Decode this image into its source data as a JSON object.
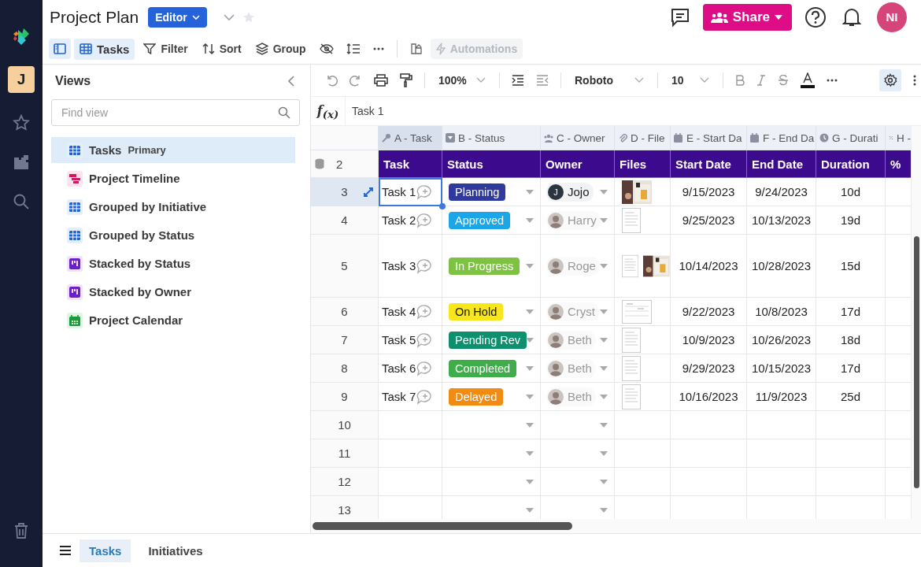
{
  "document": {
    "title": "Project Plan",
    "role": "Editor"
  },
  "header_actions": {
    "share": "Share",
    "avatar": "NI"
  },
  "toolbar": [
    {
      "kind": "panel",
      "selected": true
    },
    {
      "kind": "view",
      "label": "Tasks",
      "selected": true
    },
    {
      "kind": "filter",
      "label": "Filter"
    },
    {
      "kind": "sort",
      "label": "Sort"
    },
    {
      "kind": "group",
      "label": "Group"
    },
    {
      "kind": "hide"
    },
    {
      "kind": "rowheight"
    },
    {
      "kind": "more"
    },
    {
      "kind": "chart"
    },
    {
      "kind": "automations",
      "label": "Automations",
      "disabled": true
    }
  ],
  "workspace": {
    "initial": "J"
  },
  "views_panel": {
    "title": "Views",
    "search": {
      "placeholder": "Find view"
    },
    "views": [
      {
        "label": "Tasks",
        "badge": "Primary",
        "kind": "grid",
        "selected": true
      },
      {
        "label": "Project Timeline",
        "kind": "timeline",
        "selected": false
      },
      {
        "label": "Grouped by Initiative",
        "kind": "grid",
        "selected": false
      },
      {
        "label": "Grouped by Status",
        "kind": "grid",
        "selected": false
      },
      {
        "label": "Stacked by Status",
        "kind": "board",
        "selected": false
      },
      {
        "label": "Stacked by Owner",
        "kind": "board",
        "selected": false
      },
      {
        "label": "Project Calendar",
        "kind": "calendar",
        "selected": false
      }
    ]
  },
  "format_bar": {
    "zoom": "100%",
    "font": "Roboto",
    "size": "10",
    "settings_on": true
  },
  "formula_bar": {
    "symbol": "f$_{(x)}$",
    "value": "Task 1"
  },
  "grid": {
    "header_row": "2",
    "columns": [
      {
        "letter": "A - Task",
        "field": "Task",
        "selected": true
      },
      {
        "letter": "B - Status",
        "field": "Status",
        "selected": false
      },
      {
        "letter": "C - Owner",
        "field": "Owner",
        "selected": false
      },
      {
        "letter": "D - File",
        "field": "Files",
        "selected": false
      },
      {
        "letter": "E - Start Da",
        "field": "Start Date",
        "selected": false
      },
      {
        "letter": "F - End Da",
        "field": "End Date",
        "selected": false
      },
      {
        "letter": "G - Durati",
        "field": "Duration",
        "selected": false
      },
      {
        "letter": "H -",
        "field": "%",
        "selected": false
      }
    ],
    "rows": [
      {
        "number": "3",
        "selected": true,
        "tall": false,
        "task": "Task 1",
        "status": {
          "label": "Planning",
          "color": "#2f3a9c"
        },
        "owner": {
          "name": "Jojo",
          "kind": "initial",
          "initial": "J"
        },
        "files": [
          {
            "kind": "picture"
          }
        ],
        "start": "9/15/2023",
        "end": "9/24/2023",
        "duration": "10d"
      },
      {
        "number": "4",
        "selected": false,
        "tall": false,
        "task": "Task 2",
        "status": {
          "label": "Approved",
          "color": "#1ba6e8"
        },
        "owner": {
          "name": "Harry"
        },
        "files": [
          {
            "kind": "document"
          }
        ],
        "start": "9/25/2023",
        "end": "10/13/2023",
        "duration": "19d"
      },
      {
        "number": "5",
        "selected": false,
        "tall": true,
        "task": "Task 3",
        "status": {
          "label": "In Progress",
          "color": "#7dc242"
        },
        "owner": {
          "name": "Roge"
        },
        "files": [
          {
            "kind": "document"
          },
          {
            "kind": "picture"
          }
        ],
        "start": "10/14/2023",
        "end": "10/28/2023",
        "duration": "15d"
      },
      {
        "number": "6",
        "selected": false,
        "tall": false,
        "task": "Task 4",
        "status": {
          "label": "On Hold",
          "color": "#f7e61c"
        },
        "owner": {
          "name": "Cryst"
        },
        "files": [
          {
            "kind": "sheet"
          }
        ],
        "start": "9/22/2023",
        "end": "10/8/2023",
        "duration": "17d"
      },
      {
        "number": "7",
        "selected": false,
        "tall": false,
        "task": "Task 5",
        "status": {
          "label": "Pending Rev",
          "color": "#0e8f6d"
        },
        "owner": {
          "name": "Beth"
        },
        "files": [
          {
            "kind": "document"
          }
        ],
        "start": "10/9/2023",
        "end": "10/26/2023",
        "duration": "18d"
      },
      {
        "number": "8",
        "selected": false,
        "tall": false,
        "task": "Task 6",
        "status": {
          "label": "Completed",
          "color": "#3fae4a"
        },
        "owner": {
          "name": "Beth"
        },
        "files": [
          {
            "kind": "document"
          }
        ],
        "start": "9/29/2023",
        "end": "10/15/2023",
        "duration": "17d"
      },
      {
        "number": "9",
        "selected": false,
        "tall": false,
        "task": "Task 7",
        "status": {
          "label": "Delayed",
          "color": "#f28b12"
        },
        "owner": {
          "name": "Beth"
        },
        "files": [
          {
            "kind": "document"
          }
        ],
        "start": "10/16/2023",
        "end": "11/9/2023",
        "duration": "25d"
      },
      {
        "number": "10",
        "selected": false,
        "tall": false
      },
      {
        "number": "11",
        "selected": false,
        "tall": false
      },
      {
        "number": "12",
        "selected": false,
        "tall": false
      },
      {
        "number": "13",
        "selected": false,
        "tall": false
      }
    ]
  },
  "sheet_tabs": [
    {
      "label": "Tasks",
      "selected": true
    },
    {
      "label": "Initiatives",
      "selected": false
    }
  ]
}
